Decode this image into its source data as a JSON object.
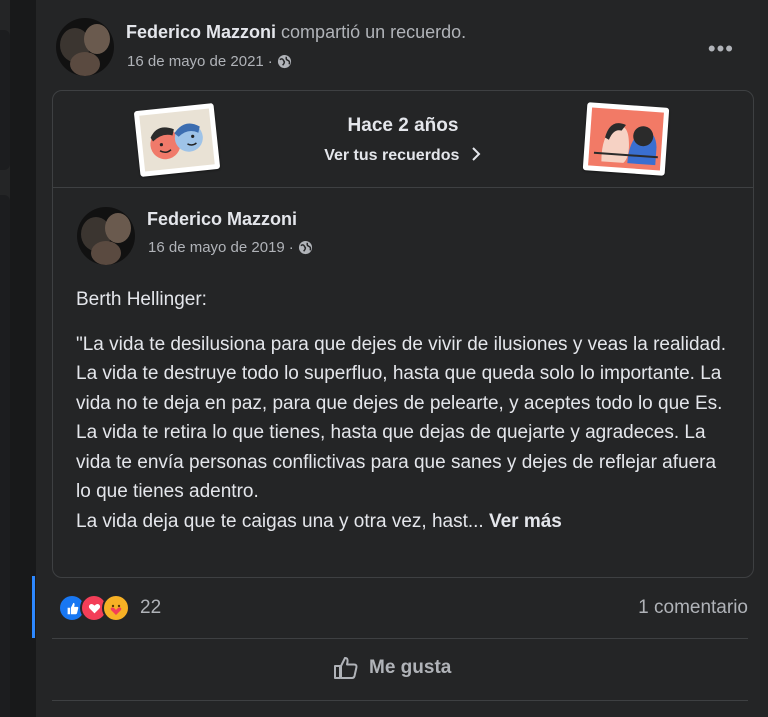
{
  "post": {
    "author": "Federico Mazzoni",
    "action": "compartió un recuerdo.",
    "date": "16 de mayo de 2021",
    "separator": "·",
    "audience_icon": "globe-icon",
    "more_icon": "more-icon",
    "more_label": "•••"
  },
  "memory": {
    "title": "Hace 2 años",
    "link_label": "Ver tus recuerdos",
    "link_icon": "chevron-right-icon"
  },
  "original": {
    "author": "Federico Mazzoni",
    "date": "16 de mayo de 2019",
    "separator": "·",
    "intro": "Berth Hellinger:",
    "body": "\"La vida te desilusiona para que dejes de vivir de ilusiones y veas la realidad. La vida te destruye todo lo superfluo, hasta que queda solo lo importante. La vida no te deja en paz, para que dejes de pelearte, y aceptes todo lo que Es. La vida te retira lo que tienes, hasta que dejas de quejarte y agradeces. La vida te envía personas conflictivas para que sanes y dejes de reflejar afuera lo que tienes adentro.",
    "last_line": "La vida deja que te caigas una y otra vez, hast...",
    "see_more": "Ver más"
  },
  "engagement": {
    "reaction_icons": [
      "like-icon",
      "love-icon",
      "care-icon"
    ],
    "reaction_count": "22",
    "comments": "1 comentario"
  },
  "actions": {
    "like_label": "Me gusta",
    "like_icon": "thumbs-up-icon"
  },
  "colors": {
    "background": "#18191a",
    "card": "#242526",
    "text": "#e4e6eb",
    "secondary_text": "#b0b3b8",
    "divider": "#3e4042",
    "accent": "#2d88ff"
  }
}
